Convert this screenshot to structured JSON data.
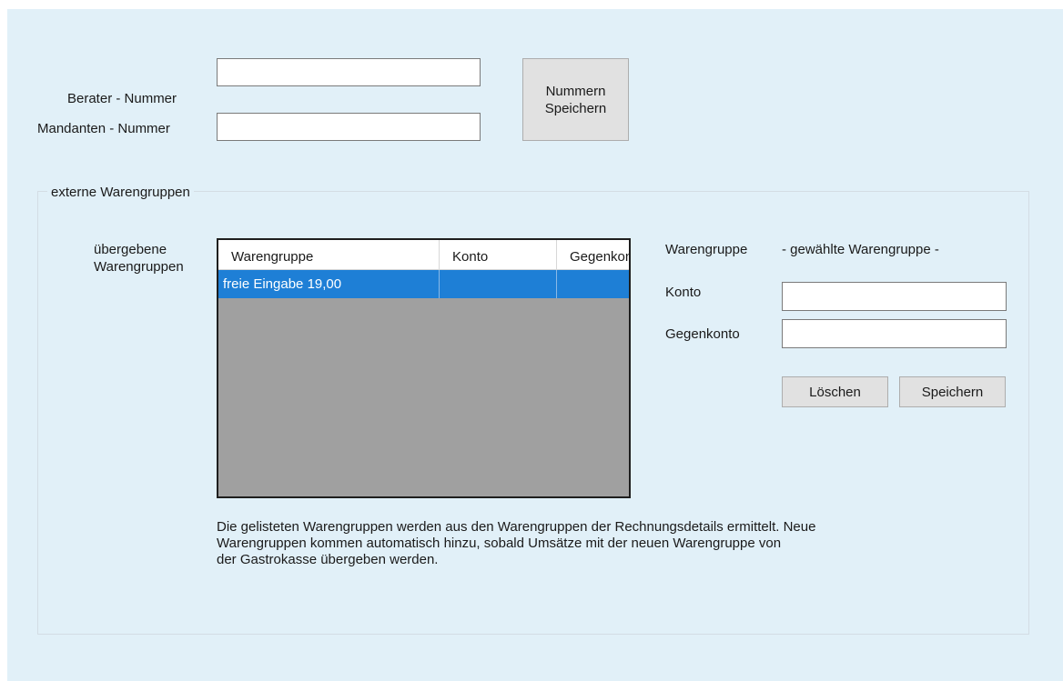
{
  "form": {
    "berater_label": "Berater - Nummer",
    "berater_value": "",
    "mandanten_label": "Mandanten - Nummer",
    "mandanten_value": "",
    "save_numbers_line1": "Nummern",
    "save_numbers_line2": "Speichern"
  },
  "group": {
    "title": "externe Warengruppen",
    "list_label_line1": "übergebene",
    "list_label_line2": "Warengruppen",
    "grid": {
      "columns": [
        "Warengruppe",
        "Konto",
        "Gegenkonto"
      ],
      "rows": [
        {
          "warengruppe": "freie Eingabe 19,00",
          "konto": "",
          "gegenkonto": ""
        }
      ]
    },
    "detail": {
      "warengruppe_label": "Warengruppe",
      "warengruppe_value": "- gewählte Warengruppe -",
      "konto_label": "Konto",
      "konto_value": "",
      "gegenkonto_label": "Gegenkonto",
      "gegenkonto_value": "",
      "delete_label": "Löschen",
      "save_label": "Speichern"
    },
    "info_line1": "Die gelisteten Warengruppen werden aus den Warengruppen der Rechnungsdetails ermittelt. Neue",
    "info_line2": "Warengruppen kommen automatisch hinzu, sobald Umsätze mit der neuen Warengruppe von",
    "info_line3": "der Gastrokasse übergeben werden."
  },
  "colors": {
    "background": "#e1f0f8",
    "selection": "#1e7fd6",
    "grid_empty": "#a0a0a0"
  }
}
